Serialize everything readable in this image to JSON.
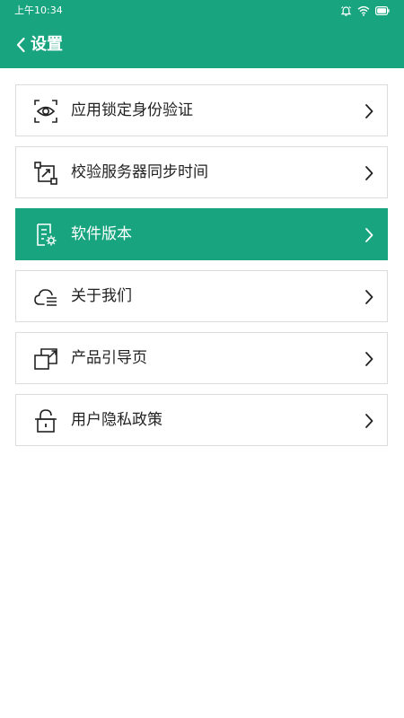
{
  "status_bar": {
    "time": "上午10:34",
    "icons": [
      "alarm-icon",
      "wifi-icon",
      "battery-icon"
    ]
  },
  "header": {
    "title": "设置",
    "back_icon": "chevron-left-icon",
    "background_color": "#17a47f"
  },
  "settings": {
    "items": [
      {
        "label": "应用锁定身份验证",
        "icon": "eye-scan-icon",
        "active": false
      },
      {
        "label": "校验服务器同步时间",
        "icon": "sync-frame-icon",
        "active": false
      },
      {
        "label": "软件版本",
        "icon": "document-gear-icon",
        "active": true
      },
      {
        "label": "关于我们",
        "icon": "cloud-list-icon",
        "active": false
      },
      {
        "label": "产品引导页",
        "icon": "window-swap-icon",
        "active": false
      },
      {
        "label": "用户隐私政策",
        "icon": "lock-icon",
        "active": false
      }
    ],
    "accent_color": "#17a47f"
  }
}
